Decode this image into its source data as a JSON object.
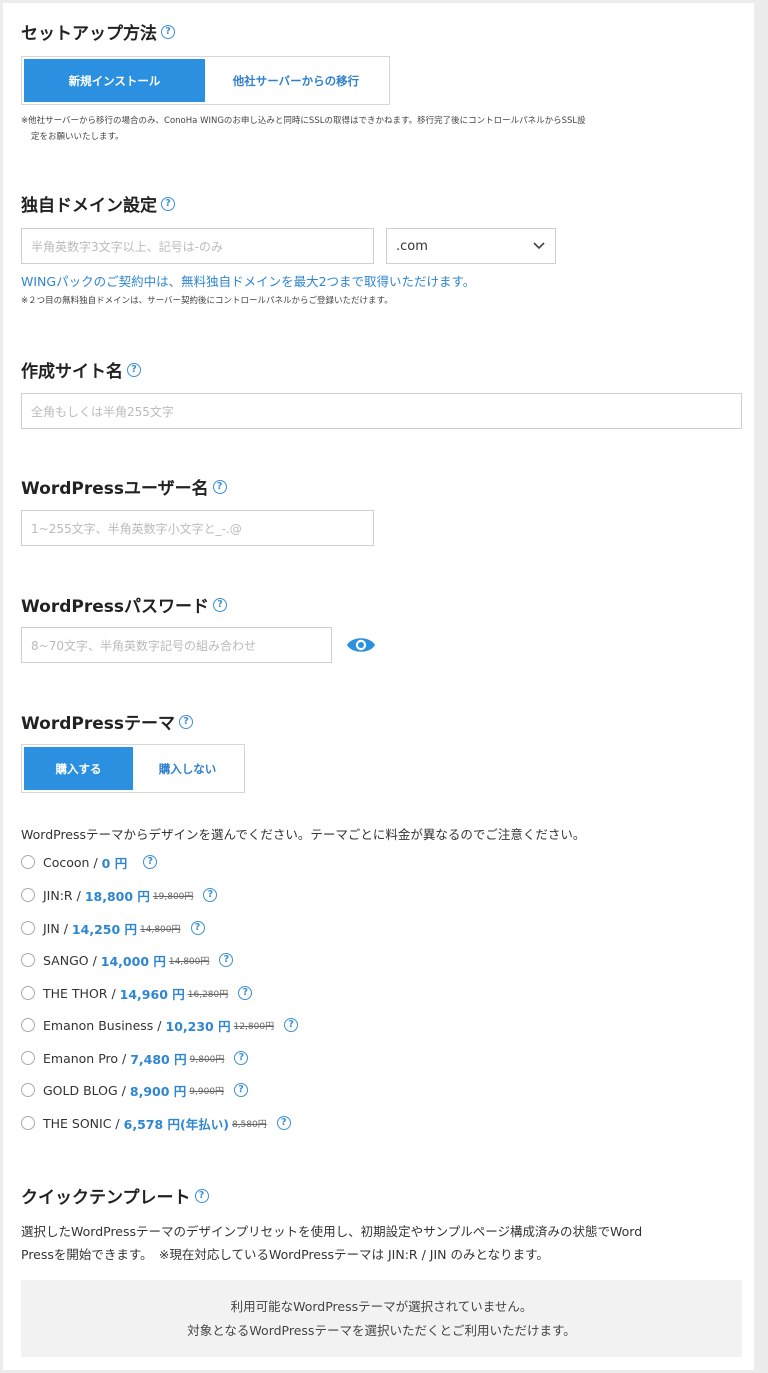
{
  "setup": {
    "title": "セットアップ方法",
    "options": [
      "新規インストール",
      "他社サーバーからの移行"
    ],
    "selected": 0,
    "note_line1": "※他社サーバーから移行の場合のみ、ConoHa WINGのお申し込みと同時にSSLの取得はできかねます。移行完了後にコントロールパネルからSSL設",
    "note_line2": "定をお願いいたします。"
  },
  "domain": {
    "title": "独自ドメイン設定",
    "input_placeholder": "半角英数字3文字以上、記号は-のみ",
    "tld_selected": ".com",
    "info": "WINGパックのご契約中は、無料独自ドメインを最大2つまで取得いただけます。",
    "note": "※２つ目の無料独自ドメインは、サーバー契約後にコントロールパネルからご登録いただけます。"
  },
  "site_name": {
    "title": "作成サイト名",
    "placeholder": "全角もしくは半角255文字"
  },
  "wp_user": {
    "title": "WordPressユーザー名",
    "placeholder": "1~255文字、半角英数字小文字と_-.@"
  },
  "wp_password": {
    "title": "WordPressパスワード",
    "placeholder": "8~70文字、半角英数字記号の組み合わせ"
  },
  "wp_theme": {
    "title": "WordPressテーマ",
    "options": [
      "購入する",
      "購入しない"
    ],
    "selected": 0,
    "description": "WordPressテーマからデザインを選んでください。テーマごとに料金が異なるのでご注意ください。",
    "themes": [
      {
        "name": "Cocoon /",
        "price": "0 円",
        "old": ""
      },
      {
        "name": "JIN:R /",
        "price": "18,800 円",
        "old": "19,800円"
      },
      {
        "name": "JIN /",
        "price": "14,250 円",
        "old": "14,800円"
      },
      {
        "name": "SANGO /",
        "price": "14,000 円",
        "old": "14,800円"
      },
      {
        "name": "THE THOR /",
        "price": "14,960 円",
        "old": "16,280円"
      },
      {
        "name": "Emanon Business /",
        "price": "10,230 円",
        "old": "12,800円"
      },
      {
        "name": "Emanon Pro /",
        "price": "7,480 円",
        "old": "9,800円"
      },
      {
        "name": "GOLD BLOG /",
        "price": "8,900 円",
        "old": "9,900円"
      },
      {
        "name": "THE SONIC /",
        "price": "6,578 円(年払い)",
        "old": "8,580円"
      }
    ]
  },
  "quick_template": {
    "title": "クイックテンプレート",
    "desc_line1": "選択したWordPressテーマのデザインプリセットを使用し、初期設定やサンプルページ構成済みの状態でWord",
    "desc_line2": "Pressを開始できます。　※現在対応しているWordPressテーマは JIN:R / JIN のみとなります。",
    "box_line1": "利用可能なWordPressテーマが選択されていません。",
    "box_line2": "対象となるWordPressテーマを選択いただくとご利用いただけます。"
  },
  "help_glyph": "?",
  "colors": {
    "accent": "#2a90df",
    "link": "#2f86d0"
  }
}
